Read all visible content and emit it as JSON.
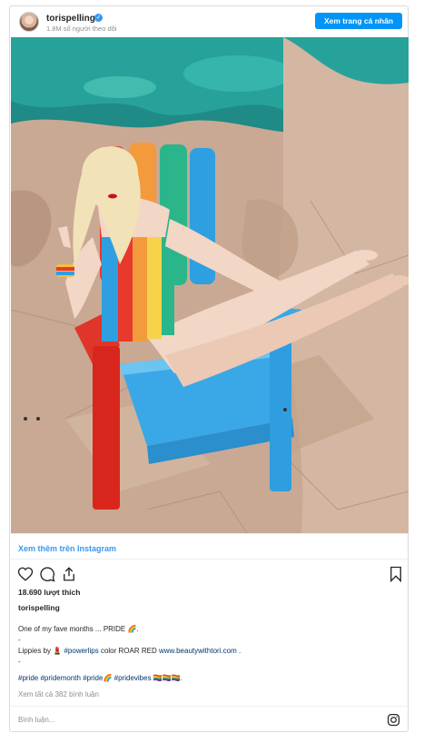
{
  "header": {
    "username": "torispelling",
    "verified_mark": "✓",
    "followers": "1.8M số người theo dõi",
    "profile_button": "Xem trang cá nhân"
  },
  "photo": {
    "subject": "woman in rainbow swimsuit on colorful chair by pool",
    "colors": {
      "pool": "#1f8a86",
      "rock": "#c9a993",
      "chair_blue": "#3aa8e6",
      "chair_red": "#d9261c"
    }
  },
  "view_more": "Xem thêm trên Instagram",
  "actions": {
    "like_icon": "heart-icon",
    "comment_icon": "comment-icon",
    "share_icon": "share-icon",
    "save_icon": "bookmark-icon"
  },
  "likes": "18.690 lượt thích",
  "post_user": "torispelling",
  "caption": {
    "line1": "One of my fave months ... PRIDE",
    "line1_emoji": "🌈",
    "line1_end": ".",
    "dash1": "-",
    "line3_prefix": "Lippies by",
    "line3_emoji": "💄",
    "line3_tag": "#powerlips",
    "line3_mid": "color ROAR RED",
    "line3_link": "www.beautywithtori.com",
    "line3_end": ".",
    "dash2": "-",
    "hashtags": [
      "#pride",
      "#pridemonth",
      "#pride",
      "#pridevibes"
    ],
    "hashtag_emoji": "🌈",
    "flags": "🏳️‍🌈🏳️‍🌈🏳️‍🌈",
    "hashtags_end": "."
  },
  "comments_link": "Xem tất cả 382 bình luận",
  "comment_placeholder": "Bình luận...",
  "brand_icon": "instagram-icon"
}
